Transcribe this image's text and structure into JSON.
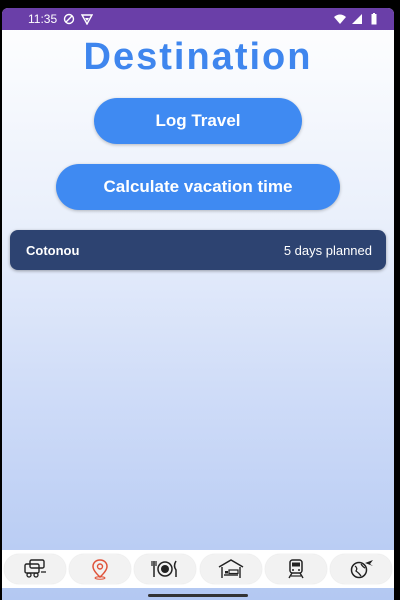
{
  "status_bar": {
    "time": "11:35",
    "icons": [
      "do-not-disturb-icon",
      "vpn-icon",
      "wifi-icon",
      "signal-icon",
      "battery-icon"
    ]
  },
  "page_title": "Destination",
  "buttons": {
    "log_travel": "Log Travel",
    "calculate": "Calculate vacation time"
  },
  "destinations": [
    {
      "city": "Cotonou",
      "days": "5 days planned"
    }
  ],
  "bottom_nav": [
    {
      "name": "nav-transport",
      "icon": "vehicles-icon",
      "color": "#222222"
    },
    {
      "name": "nav-destination",
      "icon": "location-pin-icon",
      "color": "#e0533a"
    },
    {
      "name": "nav-food",
      "icon": "dining-icon",
      "color": "#222222"
    },
    {
      "name": "nav-accommodation",
      "icon": "hotel-bed-icon",
      "color": "#222222"
    },
    {
      "name": "nav-train",
      "icon": "train-icon",
      "color": "#222222"
    },
    {
      "name": "nav-world",
      "icon": "globe-plane-icon",
      "color": "#222222"
    }
  ],
  "colors": {
    "accent": "#3f8af2",
    "title": "#3f86ee",
    "card": "#2d4371",
    "status_bar": "#6a3fa8"
  }
}
